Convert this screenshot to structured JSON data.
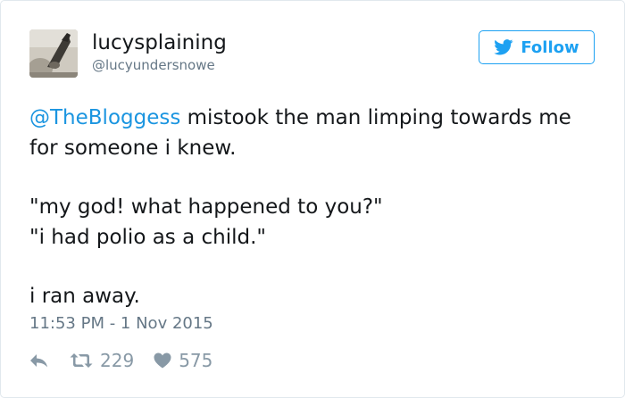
{
  "user": {
    "display_name": "lucysplaining",
    "handle": "@lucyundersnowe",
    "avatar_icon": "profile-photo"
  },
  "follow_button": {
    "label": "Follow",
    "icon": "twitter-bird-icon",
    "color": "#1da1f2"
  },
  "tweet": {
    "mention": "@TheBloggess",
    "line1_rest": " mistook the man limping towards me",
    "line2": "for someone i knew.",
    "line3": "\"my god! what happened to you?\"",
    "line4": "\"i had polio as a child.\"",
    "line5": "i ran away.",
    "mention_color": "#1b95e0"
  },
  "timestamp": "11:53 PM - 1 Nov 2015",
  "actions": {
    "reply_icon": "reply-icon",
    "retweet_icon": "retweet-icon",
    "retweet_count": "229",
    "like_icon": "heart-icon",
    "like_count": "575"
  }
}
